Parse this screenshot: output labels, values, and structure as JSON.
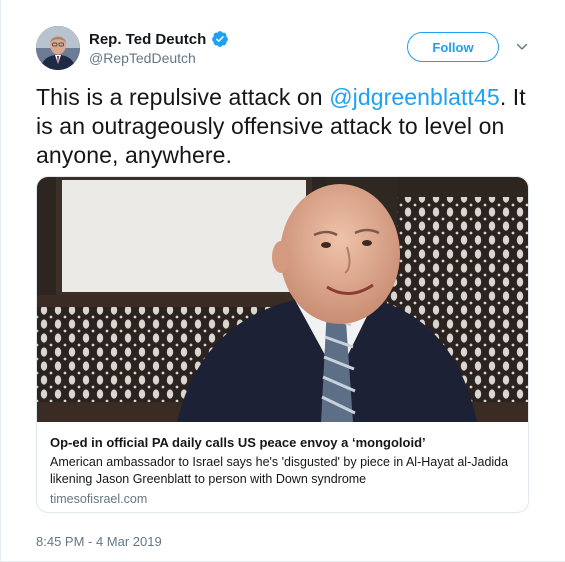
{
  "author": {
    "name": "Rep. Ted Deutch",
    "handle": "@RepTedDeutch",
    "verified": true,
    "avatar_icon": "profile-photo"
  },
  "actions": {
    "follow_label": "Follow",
    "menu_icon": "chevron-down-icon"
  },
  "tweet": {
    "text_before": "This is a repulsive attack on ",
    "mention": "@jdgreenblatt45",
    "text_after": ". It is an outrageously offensive attack to level on anyone, anywhere."
  },
  "card": {
    "title": "Op-ed in official PA daily calls US peace envoy a ‘mongoloid’",
    "description": "American ambassador to Israel says he's 'disgusted' by piece in Al-Hayat al-Jadida likening Jason Greenblatt to person with Down syndrome",
    "domain": "timesofisrael.com"
  },
  "timestamp": "8:45 PM - 4 Mar 2019",
  "colors": {
    "accent": "#1da1f2",
    "text": "#14171a",
    "muted": "#657786",
    "border": "#e1e8ed"
  }
}
